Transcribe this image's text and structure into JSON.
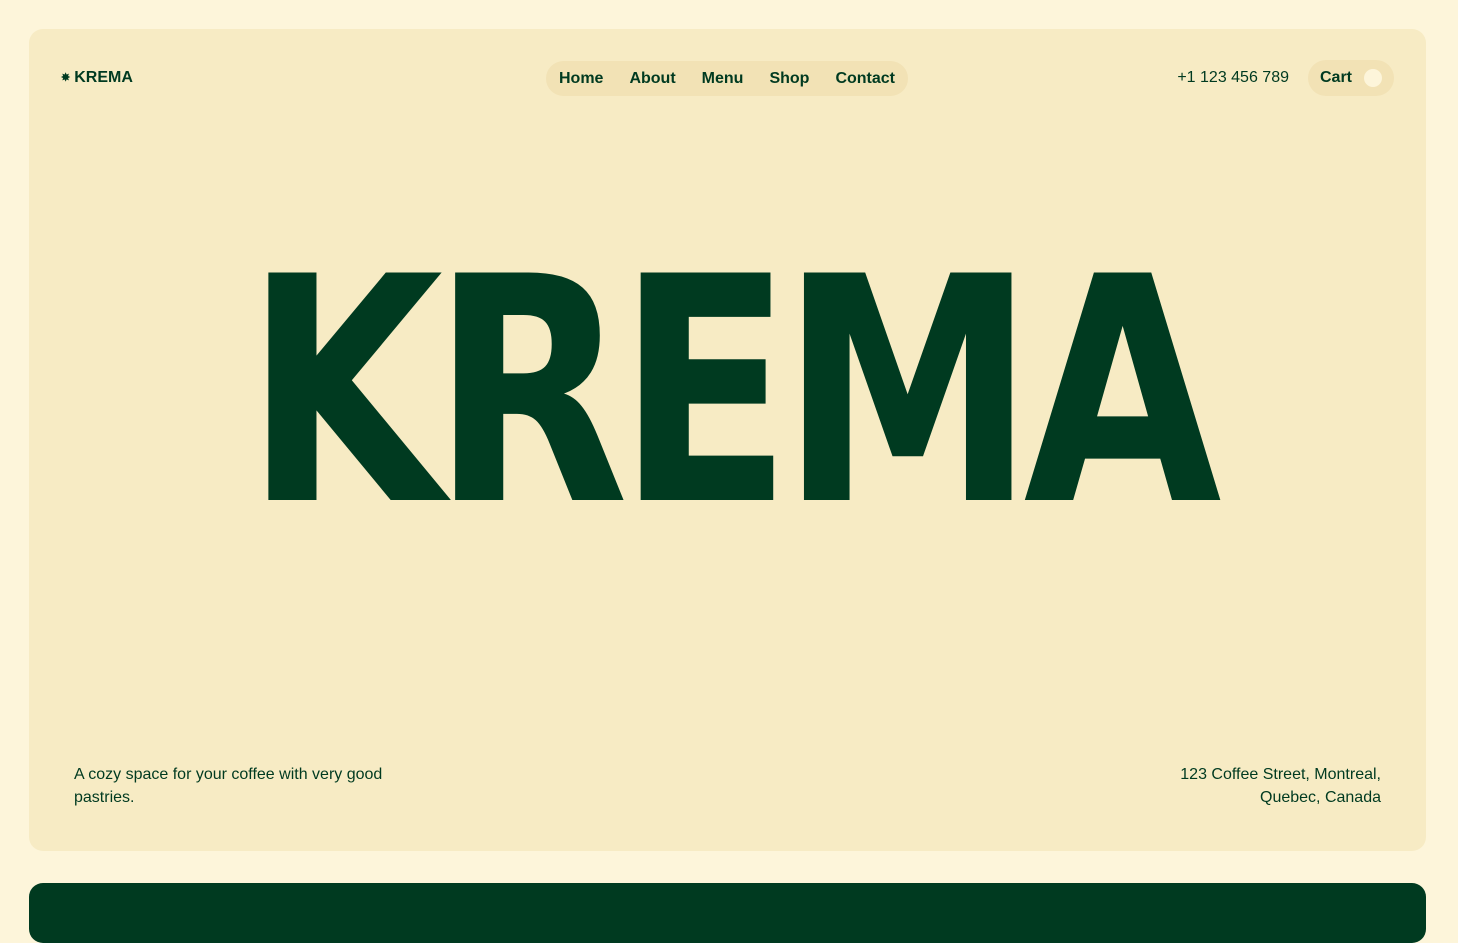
{
  "brand": {
    "logo_icon": "asterisk-star-icon",
    "logo_text": "KREMA"
  },
  "nav": {
    "items": [
      {
        "label": "Home"
      },
      {
        "label": "About"
      },
      {
        "label": "Menu"
      },
      {
        "label": "Shop"
      },
      {
        "label": "Contact"
      }
    ]
  },
  "header": {
    "phone": "+1 123 456 789",
    "cart_label": "Cart"
  },
  "hero": {
    "headline": "KREMA",
    "tagline": "A cozy space for your coffee with very good pastries.",
    "address": "123 Coffee Street, Montreal, Quebec, Canada"
  },
  "colors": {
    "page_background": "#fdf5da",
    "hero_background": "#f7ebc4",
    "pill_background": "#f2e2b5",
    "brand_green": "#003a20"
  }
}
